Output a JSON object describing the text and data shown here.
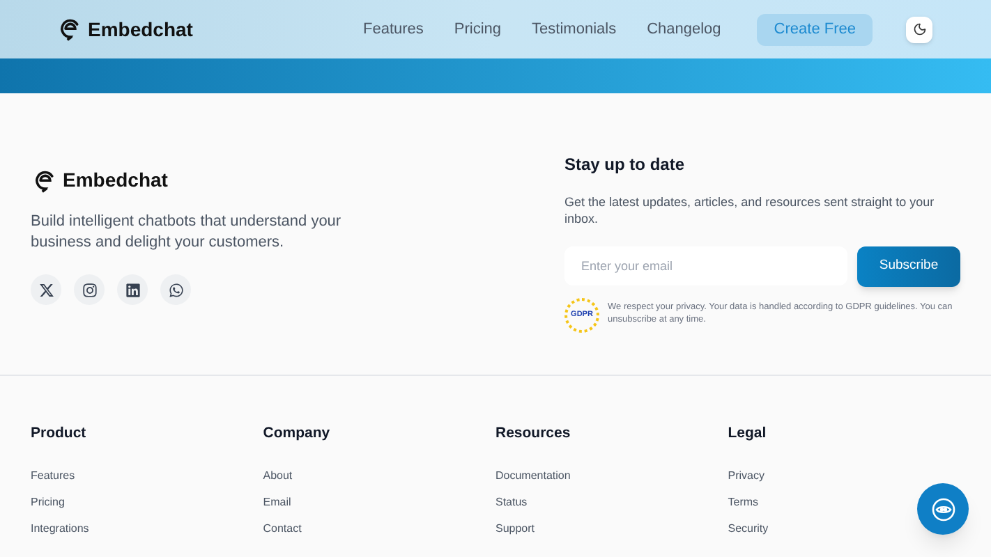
{
  "header": {
    "brand": "Embedchat",
    "nav": [
      {
        "label": "Features"
      },
      {
        "label": "Pricing"
      },
      {
        "label": "Testimonials"
      },
      {
        "label": "Changelog"
      }
    ],
    "cta": "Create Free"
  },
  "about": {
    "brand": "Embedchat",
    "description": "Build intelligent chatbots that understand your business and delight your customers.",
    "socials": [
      {
        "kind": "x"
      },
      {
        "kind": "instagram"
      },
      {
        "kind": "linkedin"
      },
      {
        "kind": "whatsapp"
      }
    ]
  },
  "newsletter": {
    "title": "Stay up to date",
    "text": "Get the latest updates, articles, and resources sent straight to your inbox.",
    "placeholder": "Enter your email",
    "button": "Subscribe",
    "badge": "GDPR",
    "privacy": "We respect your privacy. Your data is handled according to GDPR guidelines. You can unsubscribe at any time."
  },
  "columns": [
    {
      "title": "Product",
      "links": [
        "Features",
        "Pricing",
        "Integrations"
      ]
    },
    {
      "title": "Company",
      "links": [
        "About",
        "Email",
        "Contact"
      ]
    },
    {
      "title": "Resources",
      "links": [
        "Documentation",
        "Status",
        "Support"
      ]
    },
    {
      "title": "Legal",
      "links": [
        "Privacy",
        "Terms",
        "Security"
      ]
    }
  ]
}
